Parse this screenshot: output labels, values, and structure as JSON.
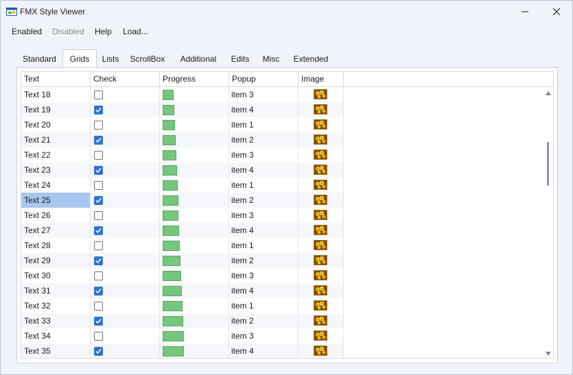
{
  "window": {
    "title": "FMX Style Viewer",
    "controls": [
      "minimize-icon",
      "maximize-icon",
      "close-icon"
    ]
  },
  "menu": [
    {
      "label": "Enabled",
      "disabled": false
    },
    {
      "label": "Disabled",
      "disabled": true
    },
    {
      "label": "Help",
      "disabled": false
    },
    {
      "label": "Load...",
      "disabled": false
    }
  ],
  "tabs": [
    {
      "label": "Standard",
      "active": false
    },
    {
      "label": "Grids",
      "active": true
    },
    {
      "label": "Lists",
      "active": false
    },
    {
      "label": "ScrollBox",
      "active": false
    },
    {
      "label": "Additional",
      "active": false
    },
    {
      "label": "Edits",
      "active": false
    },
    {
      "label": "Misc",
      "active": false
    },
    {
      "label": "Extended",
      "active": false
    }
  ],
  "grid": {
    "columns": [
      "Text",
      "Check",
      "Progress",
      "Popup",
      "Image"
    ],
    "rows": [
      {
        "text": "Text 18",
        "checked": false,
        "progress": 18,
        "popup": "item 3",
        "selected": false
      },
      {
        "text": "Text 19",
        "checked": true,
        "progress": 19,
        "popup": "item 4",
        "selected": false
      },
      {
        "text": "Text 20",
        "checked": false,
        "progress": 20,
        "popup": "item 1",
        "selected": false
      },
      {
        "text": "Text 21",
        "checked": true,
        "progress": 21,
        "popup": "item 2",
        "selected": false
      },
      {
        "text": "Text 22",
        "checked": false,
        "progress": 22,
        "popup": "item 3",
        "selected": false
      },
      {
        "text": "Text 23",
        "checked": true,
        "progress": 23,
        "popup": "item 4",
        "selected": false
      },
      {
        "text": "Text 24",
        "checked": false,
        "progress": 24,
        "popup": "item 1",
        "selected": false
      },
      {
        "text": "Text 25",
        "checked": true,
        "progress": 25,
        "popup": "item 2",
        "selected": true
      },
      {
        "text": "Text 26",
        "checked": false,
        "progress": 26,
        "popup": "item 3",
        "selected": false
      },
      {
        "text": "Text 27",
        "checked": true,
        "progress": 27,
        "popup": "item 4",
        "selected": false
      },
      {
        "text": "Text 28",
        "checked": false,
        "progress": 28,
        "popup": "item 1",
        "selected": false
      },
      {
        "text": "Text 29",
        "checked": true,
        "progress": 29,
        "popup": "item 2",
        "selected": false
      },
      {
        "text": "Text 30",
        "checked": false,
        "progress": 30,
        "popup": "item 3",
        "selected": false
      },
      {
        "text": "Text 31",
        "checked": true,
        "progress": 31,
        "popup": "item 4",
        "selected": false
      },
      {
        "text": "Text 32",
        "checked": false,
        "progress": 32,
        "popup": "item 1",
        "selected": false
      },
      {
        "text": "Text 33",
        "checked": true,
        "progress": 33,
        "popup": "item 2",
        "selected": false
      },
      {
        "text": "Text 34",
        "checked": false,
        "progress": 34,
        "popup": "item 3",
        "selected": false
      },
      {
        "text": "Text 35",
        "checked": true,
        "progress": 35,
        "popup": "item 4",
        "selected": false
      }
    ],
    "progress_max": 100,
    "image_icon": "flower-thumbnail-icon"
  },
  "colors": {
    "accent": "#2f74d0",
    "progress": "#76c77e",
    "selection": "#a7c8ee"
  }
}
